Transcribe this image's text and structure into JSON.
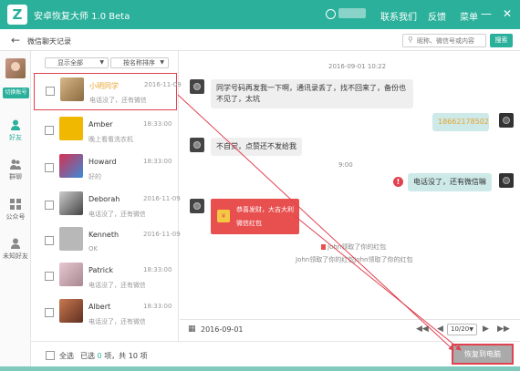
{
  "app": {
    "title": "安卓恢复大师 1.0 Beta",
    "logo_text": "Z",
    "user_name": "user",
    "contact_us": "联系我们",
    "feedback": "反馈",
    "menu": "菜单",
    "minimize": "—",
    "close": "✕"
  },
  "subbar": {
    "back_icon": "←",
    "title": "微信聊天记录",
    "search_placeholder": "昵称、微信号或内容",
    "search_button": "搜索"
  },
  "leftnav": {
    "switch_label": "切换账号",
    "items": [
      {
        "label": "好友",
        "icon": "person-icon"
      },
      {
        "label": "群聊",
        "icon": "group-icon"
      },
      {
        "label": "公众号",
        "icon": "grid-icon"
      },
      {
        "label": "未知好友",
        "icon": "unknown-user-icon"
      }
    ]
  },
  "contacts": {
    "filter_label": "显示全部",
    "sort_label": "按名称排序",
    "list": [
      {
        "name": "小明同学",
        "message": "电话没了，还有微信嘛",
        "time": "2016-11-09",
        "avatar_color": "#c8a070",
        "selected": true
      },
      {
        "name": "Amber",
        "message": "晚上看看洗衣机",
        "time": "18:33:00",
        "avatar_color": "#f0b800",
        "selected": false
      },
      {
        "name": "Howard",
        "message": "好的",
        "time": "18:33:00",
        "avatar_color": "#d83050",
        "selected": false
      },
      {
        "name": "Deborah",
        "message": "电话没了，还有微信嘛",
        "time": "2016-11-09",
        "avatar_color": "#8a8a8a",
        "selected": false
      },
      {
        "name": "Kenneth",
        "message": "OK",
        "time": "2016-11-09",
        "avatar_color": "#b8b8b8",
        "selected": false
      },
      {
        "name": "Patrick",
        "message": "电话没了，还有微信嘛",
        "time": "18:33:00",
        "avatar_color": "#d8b0b8",
        "selected": false
      },
      {
        "name": "Albert",
        "message": "电话没了，还有微信嘛",
        "time": "18:33:00",
        "avatar_color": "#a05838",
        "selected": false
      }
    ]
  },
  "chat": {
    "date_top": "2016-09-01 10:22",
    "msg1": "同学号码再发我一下啊，通讯录丢了，找不回来了，备份也不见了，太坑",
    "msg2": "18662178502",
    "msg3": "不自觉，点赞还不发给我",
    "time_mid": "9:00",
    "msg4": "电话没了，还有微信嘛",
    "err_mark": "!",
    "redpacket_line1": "恭喜发财，大吉大利",
    "redpacket_line2": "微信红包",
    "system1": "John领取了你的红包",
    "system2": "John领取了你的红包John领取了你的红包"
  },
  "datebar": {
    "date": "2016-09-01",
    "page": "10/20"
  },
  "footer": {
    "select_all": "全选",
    "selected_prefix": "已选",
    "selected_count": "0",
    "selected_mid": "项，共",
    "total_count": "10",
    "total_suffix": "项",
    "restore_button": "恢复到电脑"
  }
}
